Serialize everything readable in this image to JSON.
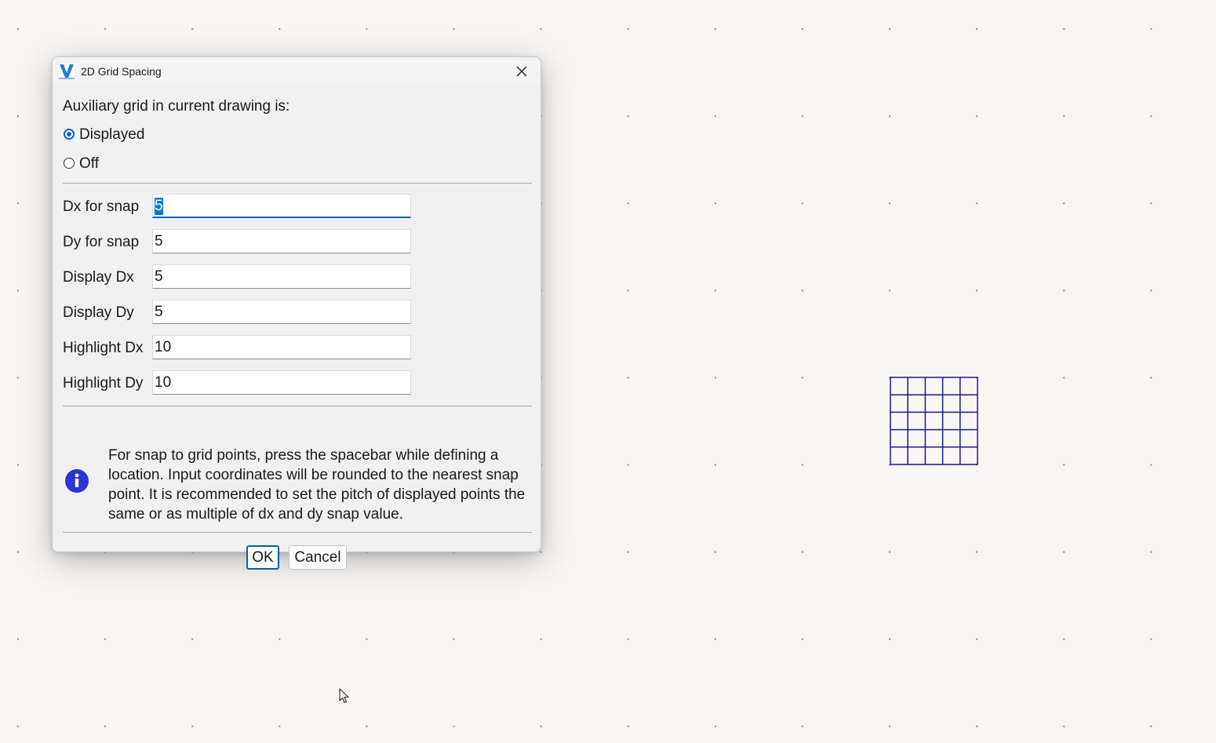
{
  "dialog": {
    "title": "2D Grid Spacing",
    "section_label": "Auxiliary grid in current drawing is:",
    "radio_options": [
      {
        "label": "Displayed",
        "selected": true
      },
      {
        "label": "Off",
        "selected": false
      }
    ],
    "fields": [
      {
        "label": "Dx for snap",
        "value": "5"
      },
      {
        "label": "Dy for snap",
        "value": "5"
      },
      {
        "label": "Display Dx",
        "value": "5"
      },
      {
        "label": "Display Dy",
        "value": "5"
      },
      {
        "label": "Highlight Dx",
        "value": "10"
      },
      {
        "label": "Highlight Dy",
        "value": "10"
      }
    ],
    "info_text": "For snap to grid points, press the spacebar while defining a location. Input coordinates will be rounded to the nearest snap point. It is recommended to set the pitch of displayed points the same or as multiple of dx and dy snap value.",
    "ok_label": "OK",
    "cancel_label": "Cancel"
  },
  "icons": {
    "app": "app-logo-icon",
    "close": "close-icon",
    "info": "info-icon",
    "cursor": "mouse-pointer-icon"
  },
  "colors": {
    "canvas_background": "#f8f5f2",
    "grid_dot": "#8c8c8c",
    "grid_symbol": "#1a1a8c",
    "radio_accent": "#0f5fc6",
    "info_icon": "#2b35d6",
    "default_button_border": "#0a5ea0"
  }
}
